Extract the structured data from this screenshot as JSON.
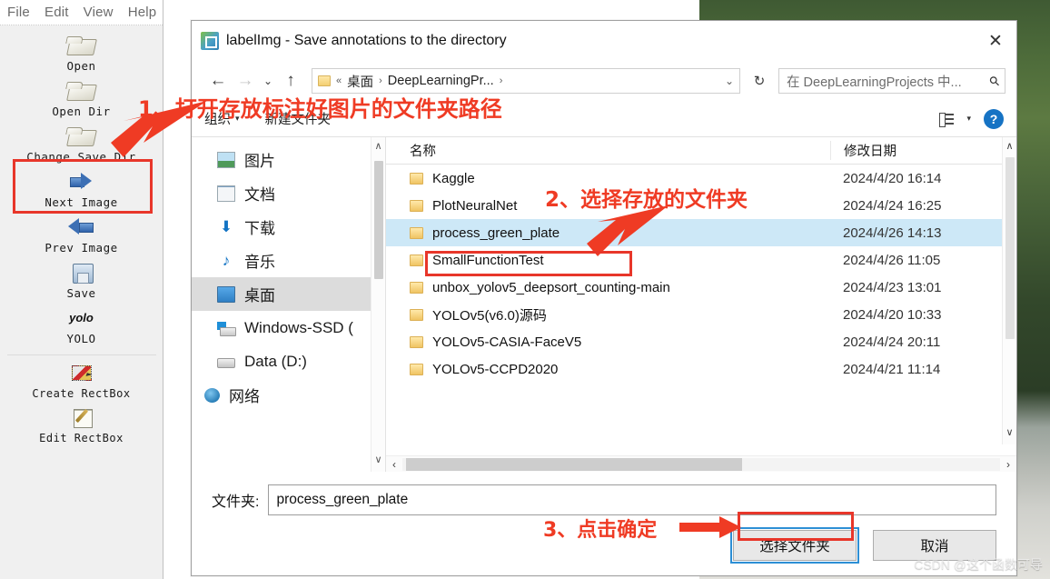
{
  "app": {
    "menus": [
      {
        "label": "File"
      },
      {
        "label": "Edit"
      },
      {
        "label": "View"
      },
      {
        "label": "Help"
      }
    ],
    "tools": [
      {
        "label": "Open",
        "icon": "open-folder-icon"
      },
      {
        "label": "Open Dir",
        "icon": "open-folder-icon"
      },
      {
        "label": "Change Save Dir",
        "icon": "open-folder-icon"
      },
      {
        "label": "Next Image",
        "icon": "arrow-right-icon"
      },
      {
        "label": "Prev Image",
        "icon": "arrow-left-icon"
      },
      {
        "label": "Save",
        "icon": "floppy-disk-icon"
      },
      {
        "label": "YOLO",
        "icon": "yolo-icon",
        "icon_text": "yolo"
      },
      {
        "label": "Create RectBox",
        "icon": "create-rectbox-icon"
      },
      {
        "label": "Edit RectBox",
        "icon": "edit-rectbox-icon"
      }
    ]
  },
  "dialog": {
    "title": "labelImg - Save annotations to the directory",
    "close_label": "✕",
    "nav": {
      "back": "←",
      "forward": "→",
      "recent": "⌄",
      "up": "↑",
      "refresh": "↻",
      "address": {
        "sep": "«",
        "segments": [
          "桌面",
          "DeepLearningPr..."
        ],
        "chevron": "›",
        "dropdown": "⌄"
      },
      "search": {
        "placeholder": "在 DeepLearningProjects 中...",
        "icon": "search-icon"
      }
    },
    "commandbar": {
      "organize": "组织",
      "organize_caret": "▾",
      "new_folder": "新建文件夹",
      "view_icon": "view-mode-icon",
      "view_caret": "▾",
      "help_icon": "help-icon",
      "help_label": "?"
    },
    "nav_pane": {
      "items": [
        {
          "label": "图片",
          "icon": "pictures-icon",
          "selected": false
        },
        {
          "label": "文档",
          "icon": "documents-icon",
          "selected": false
        },
        {
          "label": "下载",
          "icon": "downloads-icon",
          "glyph": "⬇",
          "selected": false
        },
        {
          "label": "音乐",
          "icon": "music-icon",
          "glyph": "♪",
          "selected": false
        },
        {
          "label": "桌面",
          "icon": "desktop-icon",
          "selected": true
        },
        {
          "label": "Windows-SSD (",
          "icon": "windows-drive-icon",
          "selected": false
        },
        {
          "label": "Data (D:)",
          "icon": "drive-icon",
          "selected": false
        },
        {
          "label": "网络",
          "icon": "network-icon",
          "selected": false
        }
      ],
      "scroll_up": "∧",
      "scroll_down": "∨"
    },
    "file_list": {
      "columns": {
        "name": "名称",
        "date": "修改日期"
      },
      "sort_indicator": "⌃",
      "rows": [
        {
          "name": "Kaggle",
          "date": "2024/4/20 16:14",
          "selected": false
        },
        {
          "name": "PlotNeuralNet",
          "date": "2024/4/24 16:25",
          "selected": false
        },
        {
          "name": "process_green_plate",
          "date": "2024/4/26 14:13",
          "selected": true
        },
        {
          "name": "SmallFunctionTest",
          "date": "2024/4/26 11:05",
          "selected": false
        },
        {
          "name": "unbox_yolov5_deepsort_counting-main",
          "date": "2024/4/23 13:01",
          "selected": false
        },
        {
          "name": "YOLOv5(v6.0)源码",
          "date": "2024/4/20 10:33",
          "selected": false
        },
        {
          "name": "YOLOv5-CASIA-FaceV5",
          "date": "2024/4/24 20:11",
          "selected": false
        },
        {
          "name": "YOLOv5-CCPD2020",
          "date": "2024/4/21 11:14",
          "selected": false
        }
      ],
      "v_scroll_up": "∧",
      "v_scroll_down": "∨",
      "h_scroll_left": "‹",
      "h_scroll_right": "›"
    },
    "footer": {
      "folder_label": "文件夹:",
      "folder_value": "process_green_plate",
      "confirm_label": "选择文件夹",
      "cancel_label": "取消"
    }
  },
  "annotations": [
    {
      "id": 1,
      "text": "1、打开存放标注好图片的文件夹路径"
    },
    {
      "id": 2,
      "text": "2、选择存放的文件夹"
    },
    {
      "id": 3,
      "text": "3、点击确定"
    }
  ],
  "watermark": "CSDN @这个函数可导",
  "colors": {
    "annotation_red": "#ef3b24",
    "highlight_box_red": "#e8362a",
    "selection_blue": "#cde8f7",
    "accent_blue": "#1673c4"
  }
}
